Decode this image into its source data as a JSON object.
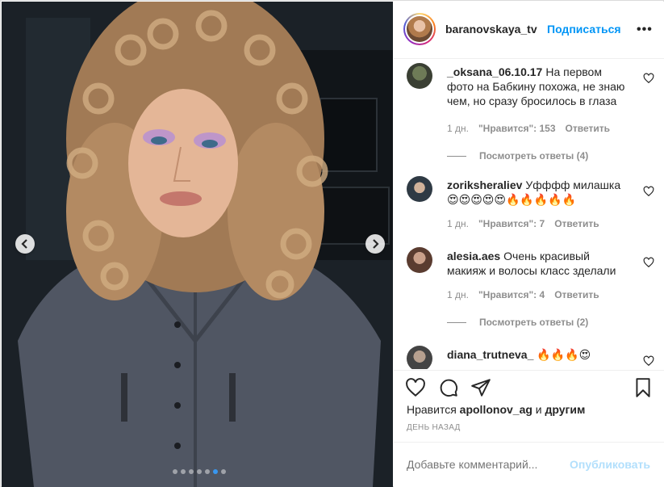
{
  "post": {
    "username": "baranovskaya_tv",
    "separator": "•",
    "follow_label": "Подписаться",
    "more_icon": "more-horizontal-icon",
    "carousel": {
      "prev_icon": "chevron-left-icon",
      "next_icon": "chevron-right-icon",
      "slide_count": 7,
      "active_slide": 6
    }
  },
  "comments": [
    {
      "user": "_oksana_06.10.17",
      "text": "На первом фото на Бабкину похожа, не знаю чем, но сразу бросилось в глаза",
      "age": "1 дн.",
      "likes": "\"Нравится\": 153",
      "reply": "Ответить",
      "view_replies": "Посмотреть ответы (4)"
    },
    {
      "user": "zoriksheraliev",
      "text": "Уфффф милашка 😍😍😍😍😍🔥🔥🔥🔥🔥",
      "age": "1 дн.",
      "likes": "\"Нравится\": 7",
      "reply": "Ответить"
    },
    {
      "user": "alesia.aes",
      "text": "Очень красивый макияж и волосы класс зделали",
      "age": "1 дн.",
      "likes": "\"Нравится\": 4",
      "reply": "Ответить",
      "view_replies": "Посмотреть ответы (2)"
    },
    {
      "user": "diana_trutneva_",
      "text": "🔥🔥🔥😍"
    }
  ],
  "footer": {
    "liked_by_prefix": "Нравится",
    "liked_by_user": "apollonov_ag",
    "liked_by_and": "и",
    "liked_by_others": "другим",
    "date": "ДЕНЬ НАЗАД",
    "comment_placeholder": "Добавьте комментарий...",
    "publish_label": "Опубликовать"
  },
  "colors": {
    "accent": "#0095f6",
    "publish_disabled": "#b2dffc",
    "meta": "#8e8e8e",
    "active_dot": "#3897f0"
  }
}
